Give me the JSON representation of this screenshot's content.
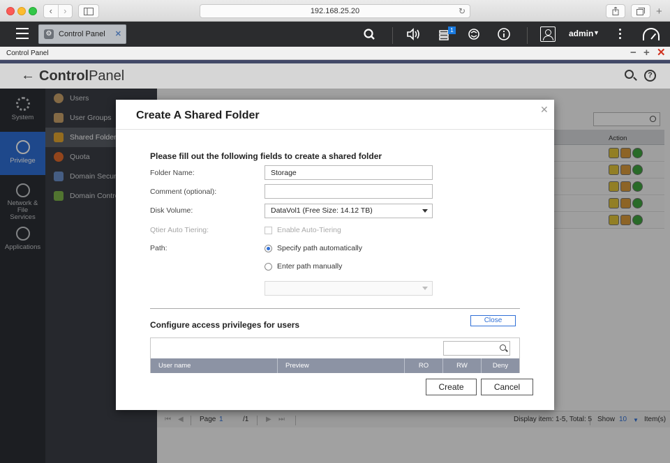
{
  "browser": {
    "url": "192.168.25.20"
  },
  "qts": {
    "tab_label": "Control Panel",
    "notification_count": "1",
    "user": "admin"
  },
  "window": {
    "title": "Control Panel"
  },
  "control_panel": {
    "title_bold": "Control",
    "title_rest": "Panel"
  },
  "nav": {
    "categories": [
      {
        "label": "System"
      },
      {
        "label": "Privilege"
      },
      {
        "label": "Network & File Services"
      },
      {
        "label": "Applications"
      }
    ],
    "active_category": "Privilege",
    "sub_items": [
      {
        "label": "Users",
        "color": "#c9a16b"
      },
      {
        "label": "User Groups",
        "color": "#c9a16b"
      },
      {
        "label": "Shared Folders",
        "color": "#e3a631"
      },
      {
        "label": "Quota",
        "color": "#e06a2b"
      },
      {
        "label": "Domain Security",
        "color": "#6a8fc9"
      },
      {
        "label": "Domain Controller",
        "color": "#7db24a"
      }
    ],
    "active_sub": "Shared Folders"
  },
  "background_table": {
    "action_header": "Action",
    "row_count": 5
  },
  "pager": {
    "page_label": "Page",
    "page_value": "1",
    "page_total": "/1",
    "display_info": "Display item: 1-5, Total: 5",
    "show_label": "Show",
    "show_value": "10",
    "items_label": "Item(s)"
  },
  "dialog": {
    "title": "Create A Shared Folder",
    "intro": "Please fill out the following fields to create a shared folder",
    "fields": {
      "folder_name_label": "Folder Name:",
      "folder_name_value": "Storage",
      "comment_label": "Comment (optional):",
      "comment_value": "",
      "disk_volume_label": "Disk Volume:",
      "disk_volume_value": "DataVol1 (Free Size: 14.12 TB)",
      "qtier_label": "Qtier Auto Tiering:",
      "qtier_option": "Enable Auto-Tiering",
      "path_label": "Path:",
      "path_auto": "Specify path automatically",
      "path_manual": "Enter path manually",
      "path_selected": "auto"
    },
    "privileges_title": "Configure access privileges for users",
    "close_label": "Close",
    "user_table_columns": [
      "User name",
      "Preview",
      "RO",
      "RW",
      "Deny"
    ],
    "create_label": "Create",
    "cancel_label": "Cancel"
  }
}
